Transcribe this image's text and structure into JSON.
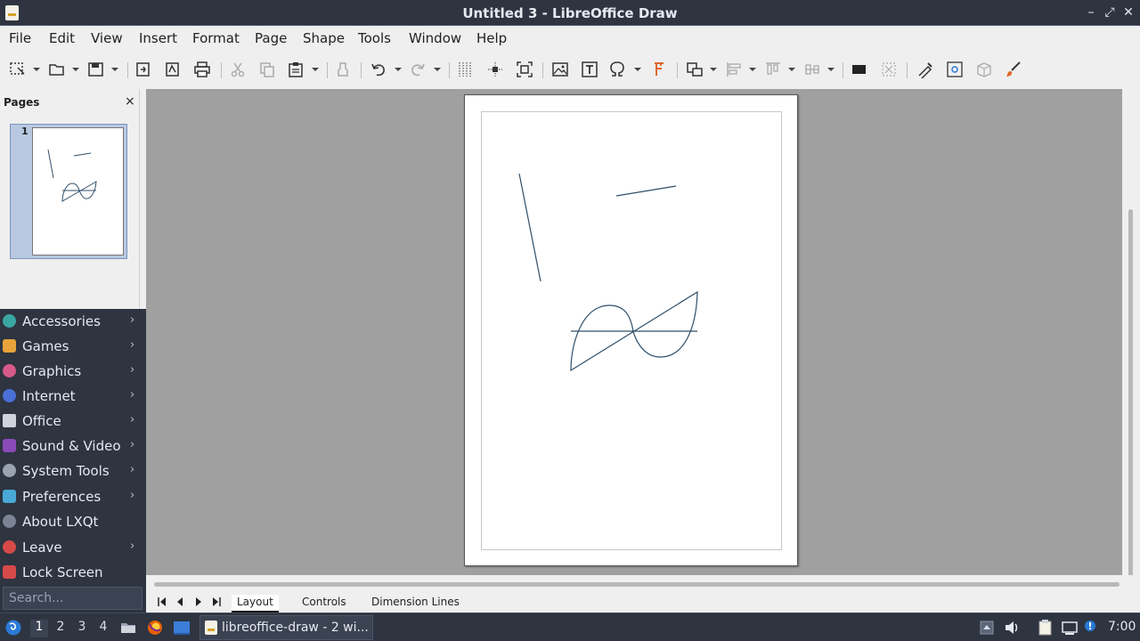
{
  "window": {
    "title": "Untitled 3 - LibreOffice Draw",
    "minimize": "–",
    "maximize": "⤢",
    "close": "✕"
  },
  "menubar": {
    "items": [
      "File",
      "Edit",
      "View",
      "Insert",
      "Format",
      "Page",
      "Shape",
      "Tools",
      "Window",
      "Help"
    ]
  },
  "toolbar": {
    "buttons": [
      "select-icon",
      "open-icon",
      "save-icon",
      "export-icon",
      "export-pdf-icon",
      "print-icon",
      "cut-icon",
      "copy-icon",
      "paste-icon",
      "clone-formatting-icon",
      "undo-icon",
      "redo-icon",
      "grid-icon",
      "helplines-icon",
      "zoom-icon",
      "image-icon",
      "textbox-icon",
      "special-character-icon",
      "fontwork-icon",
      "transformations-icon",
      "align-icon",
      "arrange-icon",
      "distribute-icon",
      "shadow-icon",
      "crop-icon",
      "points-icon",
      "glue-points-icon",
      "toggle-extrusion-icon",
      "brush-icon"
    ]
  },
  "pages_pane": {
    "title": "Pages",
    "close": "×",
    "thumbnails": [
      {
        "number": "1"
      }
    ]
  },
  "sheet_tabs": {
    "tabs": [
      "Layout",
      "Controls",
      "Dimension Lines"
    ],
    "active": "Layout"
  },
  "launcher_menu": {
    "items": [
      {
        "label": "Accessories",
        "icon": "accessories-icon",
        "color": "#3aa6a2",
        "submenu": true
      },
      {
        "label": "Games",
        "icon": "games-icon",
        "color": "#e8a33a",
        "submenu": true
      },
      {
        "label": "Graphics",
        "icon": "graphics-icon",
        "color": "#d65a8a",
        "submenu": true
      },
      {
        "label": "Internet",
        "icon": "internet-icon",
        "color": "#4a6fd6",
        "submenu": true
      },
      {
        "label": "Office",
        "icon": "office-icon",
        "color": "#cfd4dc",
        "submenu": true
      },
      {
        "label": "Sound & Video",
        "icon": "sound-video-icon",
        "color": "#8a4ab8",
        "submenu": true
      },
      {
        "label": "System Tools",
        "icon": "system-tools-icon",
        "color": "#9aa3b2",
        "submenu": true
      },
      {
        "label": "Preferences",
        "icon": "preferences-icon",
        "color": "#4aa8d6",
        "submenu": true
      },
      {
        "label": "About LXQt",
        "icon": "info-icon",
        "color": "#7b8494",
        "submenu": false
      },
      {
        "label": "Leave",
        "icon": "power-icon",
        "color": "#d64a4a",
        "submenu": true
      },
      {
        "label": "Lock Screen",
        "icon": "lock-icon",
        "color": "#d64a4a",
        "submenu": false
      }
    ],
    "arrow": "›",
    "search_placeholder": "Search..."
  },
  "taskbar": {
    "workspaces": [
      "1",
      "2",
      "3",
      "4"
    ],
    "active_workspace": "1",
    "window_label": "libreoffice-draw - 2 wi...",
    "clock": "7:00"
  },
  "colors": {
    "titlebar": "#2e3440",
    "panel": "#2e3440",
    "canvas_bg": "#a0a0a0",
    "shape_stroke": "#2f4f6a"
  }
}
